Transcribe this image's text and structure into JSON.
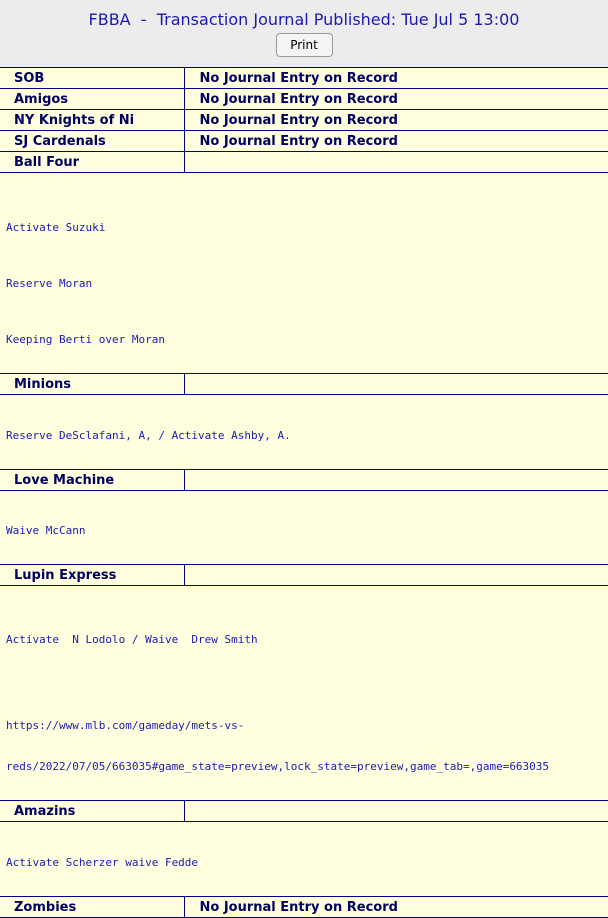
{
  "header": {
    "title": "FBBA  -  Transaction Journal Published: Tue Jul 5 13:00",
    "print_label": "Print"
  },
  "no_entry_text": "No Journal Entry on Record",
  "teams": {
    "sob": "SOB",
    "amigos": "Amigos",
    "ny_knights": "NY Knights of Ni",
    "sj_cardenals": "SJ Cardenals",
    "ball_four": "Ball Four",
    "minions": "Minions",
    "love_machine": "Love Machine",
    "lupin_express": "Lupin Express",
    "amazins": "Amazins",
    "zombies": "Zombies"
  },
  "entries": {
    "ball_four": [
      "Activate Suzuki",
      "Reserve Moran",
      "Keeping Berti over Moran"
    ],
    "minions": [
      "Reserve DeSclafani, A, / Activate Ashby, A."
    ],
    "love_machine": [
      "Waive McCann"
    ],
    "lupin_express": [
      "Activate  N Lodolo / Waive  Drew Smith",
      "https://www.mlb.com/gameday/mets-vs-",
      "reds/2022/07/05/663035#game_state=preview,lock_state=preview,game_tab=,game=663035"
    ],
    "amazins": [
      "Activate Scherzer waive Fedde"
    ]
  }
}
